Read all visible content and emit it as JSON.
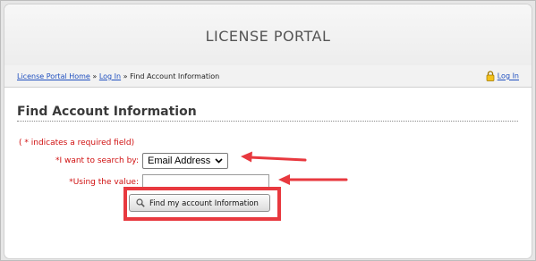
{
  "header": {
    "title": "LICENSE PORTAL"
  },
  "breadcrumb": {
    "home": "License Portal Home",
    "sep1": " » ",
    "login": "Log In",
    "sep2": " » ",
    "current": "Find Account Information"
  },
  "login_link": {
    "label": "Log In",
    "icon": "lock-icon"
  },
  "page": {
    "title": "Find Account Information",
    "required_note": "( * indicates a required field)"
  },
  "form": {
    "search_by_label": "*I want to search by:",
    "search_by_value": "Email Address",
    "value_label": "*Using the value:",
    "value_input": "",
    "submit_label": "Find my account Information",
    "submit_icon": "search-icon"
  },
  "annotation": {
    "color": "#e8393f"
  },
  "colors": {
    "link": "#1f4fbf",
    "required": "#d01010",
    "title": "#3a3a3a"
  }
}
